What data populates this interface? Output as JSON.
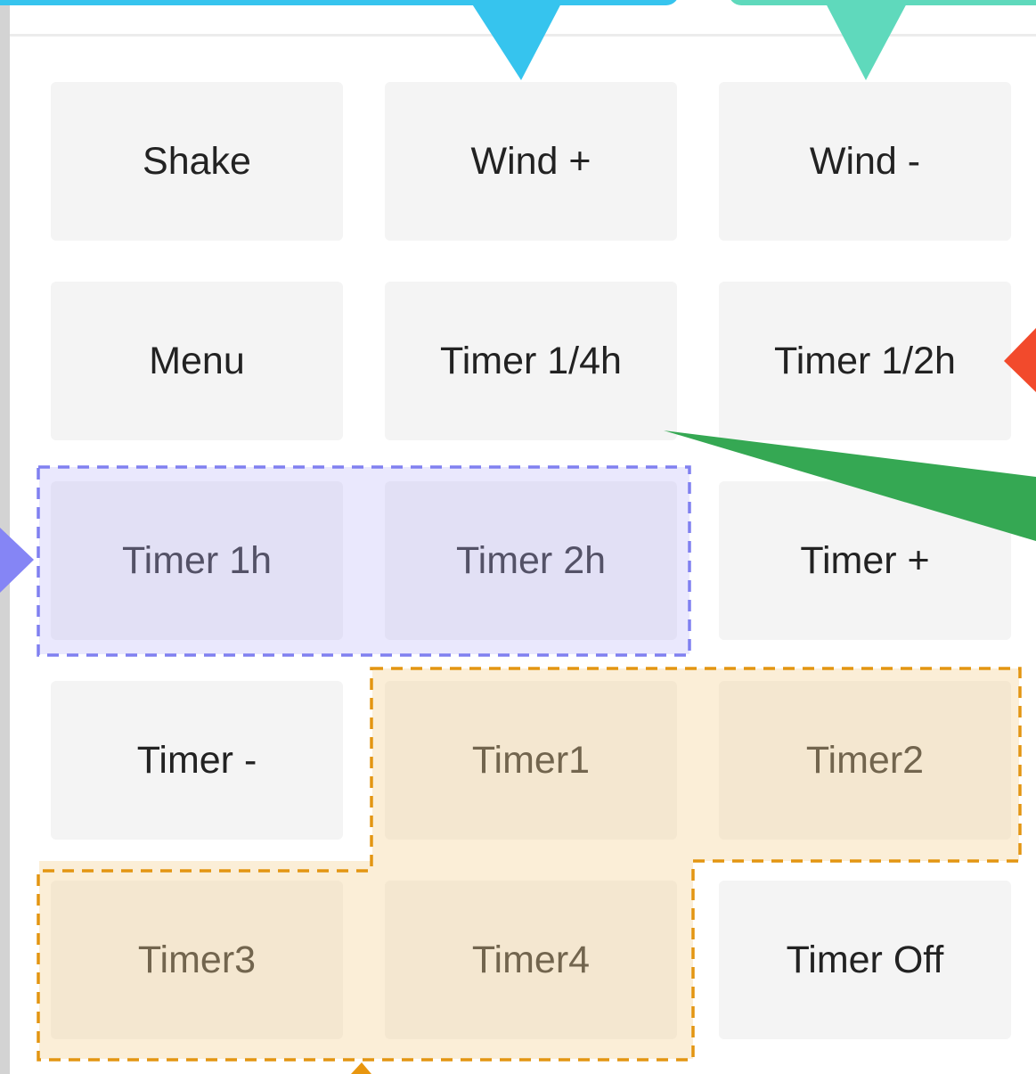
{
  "buttons": [
    {
      "label": "Shake"
    },
    {
      "label": "Wind +"
    },
    {
      "label": "Wind -"
    },
    {
      "label": "Menu"
    },
    {
      "label": "Timer 1/4h"
    },
    {
      "label": "Timer 1/2h"
    },
    {
      "label": "Timer 1h"
    },
    {
      "label": "Timer 2h"
    },
    {
      "label": "Timer +"
    },
    {
      "label": "Timer -"
    },
    {
      "label": "Timer1"
    },
    {
      "label": "Timer2"
    },
    {
      "label": "Timer3"
    },
    {
      "label": "Timer4"
    },
    {
      "label": "Timer Off"
    }
  ],
  "colors": {
    "button_bg": "#f4f4f4",
    "callout_blue": "#36c4ee",
    "callout_teal": "#5fd9bc",
    "callout_red": "#f24a2c",
    "callout_green": "#35a853",
    "callout_purple": "#8585f5",
    "callout_orange": "#e8960f",
    "group_purple_border": "#8080f0",
    "group_orange_border": "#e39512"
  }
}
